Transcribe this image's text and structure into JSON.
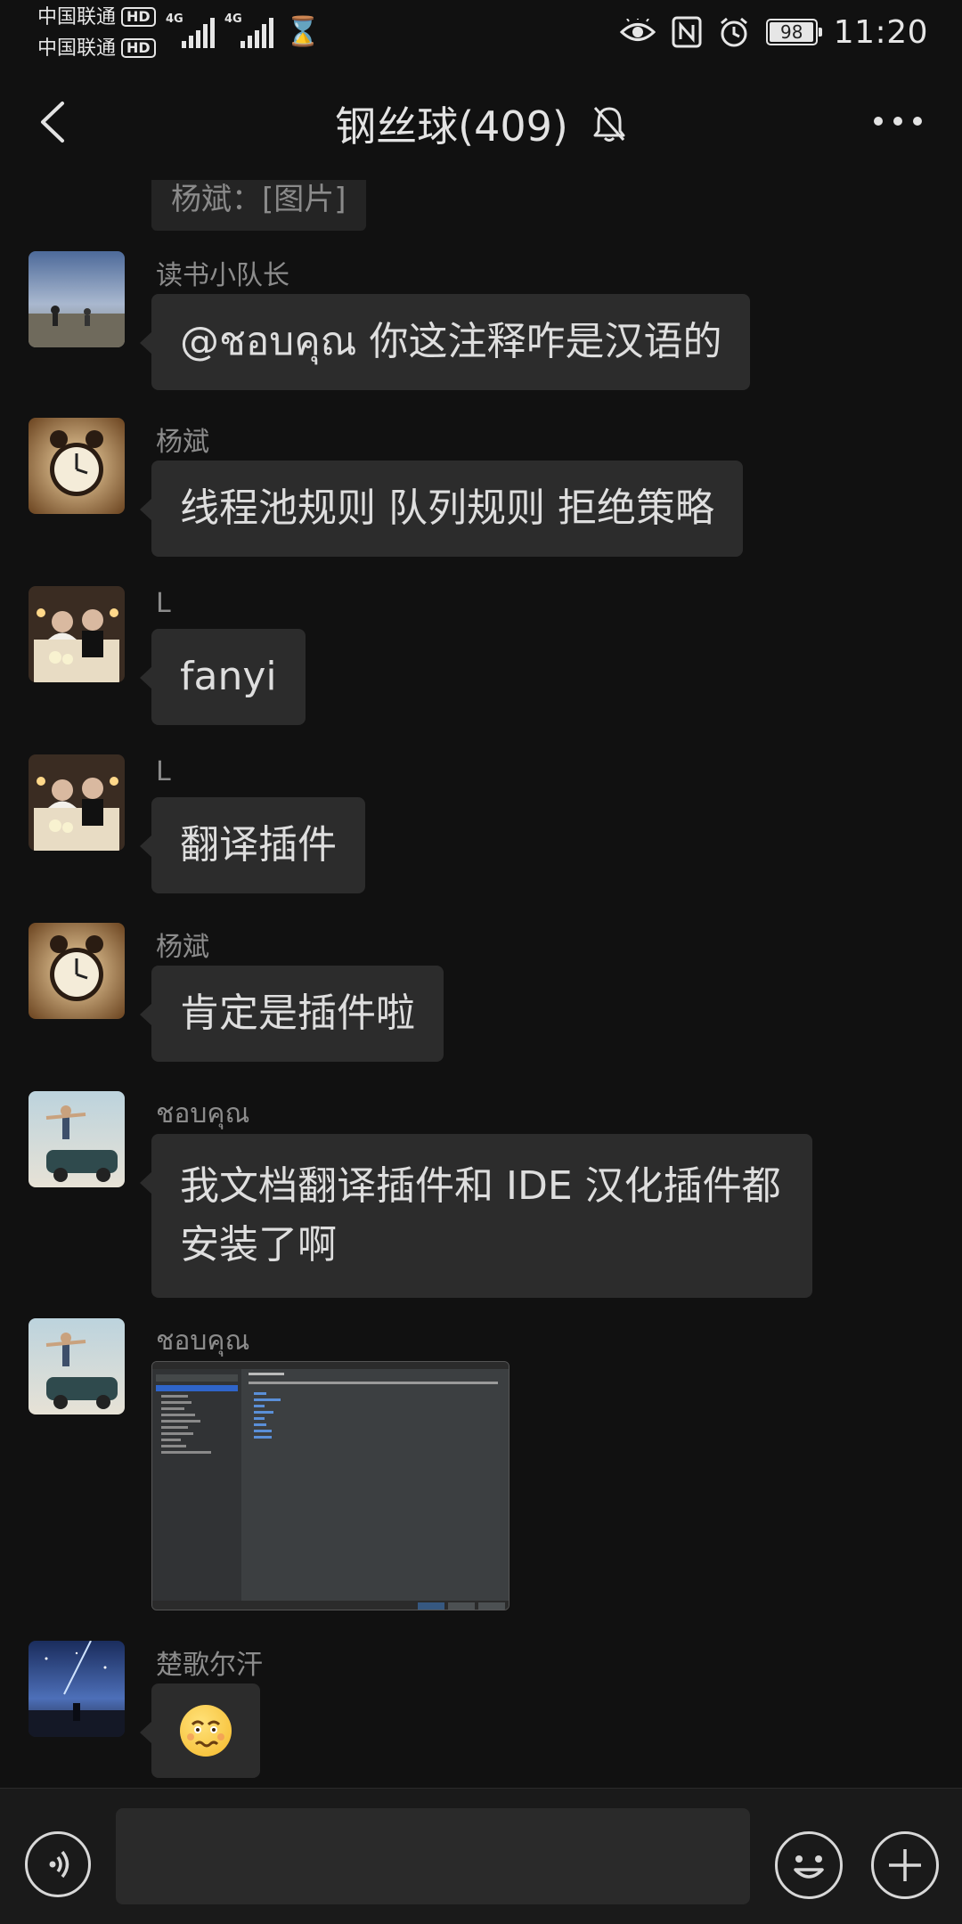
{
  "status_bar": {
    "carrier1": "中国联通",
    "carrier2": "中国联通",
    "hd": "HD",
    "network1": "4G",
    "network2": "4G",
    "battery": "98",
    "battery_level_percent": 98,
    "time": "11:20"
  },
  "header": {
    "title": "钢丝球(409)",
    "back_icon": "chevron-left-icon",
    "mute_icon": "bell-off-icon",
    "more_icon": "more-dots-icon"
  },
  "quoted_message": "杨斌：[图片]",
  "messages": [
    {
      "sender": "读书小队长",
      "text": "@ชอบคุณ 你这注释咋是汉语的",
      "avatar": "avatar-landscape"
    },
    {
      "sender": "杨斌",
      "text": "线程池规则 队列规则 拒绝策略",
      "avatar": "avatar-clock"
    },
    {
      "sender": "L",
      "text": "fanyi",
      "avatar": "avatar-wedding"
    },
    {
      "sender": "L",
      "text": "翻译插件",
      "avatar": "avatar-wedding"
    },
    {
      "sender": "杨斌",
      "text": "肯定是插件啦",
      "avatar": "avatar-clock"
    },
    {
      "sender": "ชอบคุณ",
      "text": "我文档翻译插件和 IDE 汉化插件都安装了啊",
      "avatar": "avatar-car"
    },
    {
      "sender": "ชอบคุณ",
      "text": "",
      "type": "image",
      "avatar": "avatar-car"
    },
    {
      "sender": "楚歌尔汗",
      "text": "",
      "type": "emoji",
      "emoji": "woozy-face-icon",
      "avatar": "avatar-night-sky"
    }
  ],
  "bottom_bar": {
    "voice_icon": "voice-icon",
    "input_value": "",
    "emoji_icon": "smile-icon",
    "plus_icon": "plus-icon"
  },
  "colors": {
    "background": "#111111",
    "bubble": "#2c2c2c",
    "sender_text": "#8c8c8c",
    "bubble_text": "#dedede"
  }
}
